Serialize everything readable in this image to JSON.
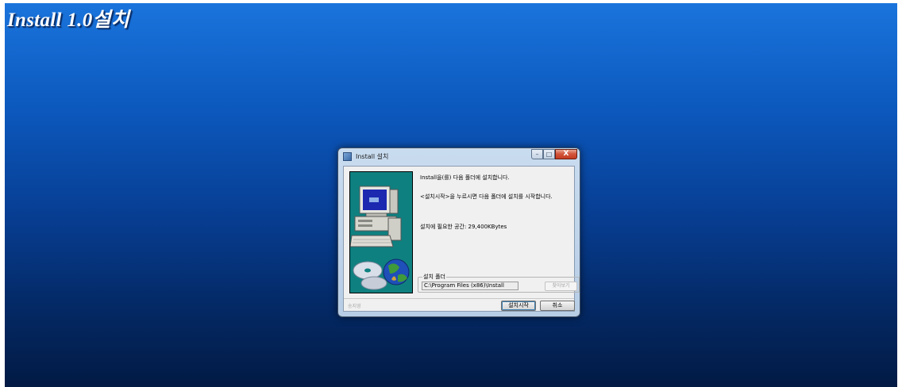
{
  "desktop": {
    "title": "Install 1.0설치"
  },
  "window": {
    "title": "Install 설치",
    "controls": {
      "minimize_icon": "minimize-icon",
      "maximize_icon": "maximize-icon",
      "close_glyph": "X"
    }
  },
  "dialog": {
    "line1": "Install을(를) 다음 폴더에 설치합니다.",
    "line2": "<설치시작>을 누르시면 다음 폴더에 설치를 시작합니다.",
    "space_required": "설치에 필요한 공간: 29,400KBytes",
    "folder_group_label": "설치 폴더",
    "install_path": "C:\\Program Files (x86)\\Install",
    "browse_label": "찾아보기",
    "author": "송지영",
    "start_label": "설치시작",
    "cancel_label": "취소"
  },
  "colors": {
    "desktop_top": "#1a74dc",
    "desktop_bottom": "#021a44",
    "picture_bg": "#0f8080",
    "close_button": "#c43b20"
  }
}
